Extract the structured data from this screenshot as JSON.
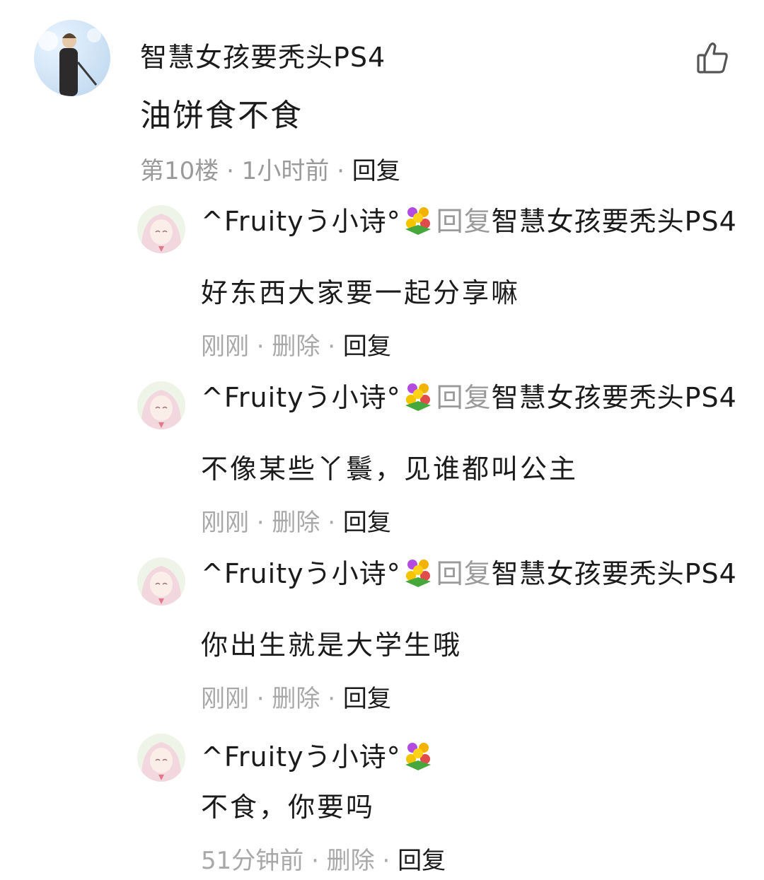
{
  "main_comment": {
    "username": "智慧女孩要秃头PS4",
    "text": "油饼食不食",
    "meta_floor": "第10楼 · 1小时前 · ",
    "reply_label": "回复",
    "avatar_icon": "profile-photo-icon",
    "like_icon": "thumbs-up-icon"
  },
  "replies": [
    {
      "username": "^Fruityう小诗°",
      "reply_word": "回复",
      "target": "智慧女孩要秃头PS4",
      "text": "好东西大家要一起分享嘛",
      "meta": "刚刚 · 删除 · ",
      "reply_label": "回复"
    },
    {
      "username": "^Fruityう小诗°",
      "reply_word": "回复",
      "target": "智慧女孩要秃头PS4",
      "text": "不像某些丫鬟，见谁都叫公主",
      "meta": "刚刚 · 删除 · ",
      "reply_label": "回复"
    },
    {
      "username": "^Fruityう小诗°",
      "reply_word": "回复",
      "target": "智慧女孩要秃头PS4",
      "text": "你出生就是大学生哦",
      "meta": "刚刚 · 删除 · ",
      "reply_label": "回复"
    },
    {
      "username": "^Fruityう小诗°",
      "text": "不食，你要吗",
      "meta": "51分钟前 · 删除 · ",
      "reply_label": "回复"
    }
  ],
  "colors": {
    "text": "#1b1b1b",
    "muted": "#9a9a9a",
    "background": "#ffffff"
  }
}
